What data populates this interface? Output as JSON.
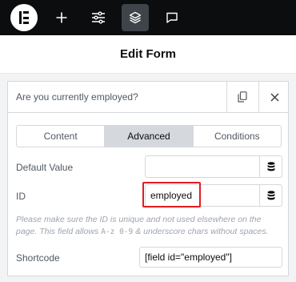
{
  "toolbar": {
    "icons": [
      "elementor-logo-icon",
      "plus-icon",
      "sliders-icon",
      "layers-icon",
      "chat-bubble-icon"
    ]
  },
  "header": {
    "title": "Edit Form"
  },
  "field": {
    "question": "Are you currently employed?"
  },
  "tabs": [
    {
      "label": "Content",
      "active": false
    },
    {
      "label": "Advanced",
      "active": true
    },
    {
      "label": "Conditions",
      "active": false
    }
  ],
  "settings": {
    "default_value": {
      "label": "Default Value",
      "value": ""
    },
    "id": {
      "label": "ID",
      "value": "employed"
    },
    "help_text_1": "Please make sure the ID is unique and not used elsewhere on the page. This field allows",
    "help_code": "A-z 0-9",
    "help_text_2": "& underscore chars without spaces.",
    "shortcode": {
      "label": "Shortcode",
      "value": "[field id=\"employed\"]"
    }
  },
  "colors": {
    "toolbar_bg": "#0c0d0e",
    "active_tab_bg": "#d5d8dc",
    "highlight": "#e11b22"
  }
}
